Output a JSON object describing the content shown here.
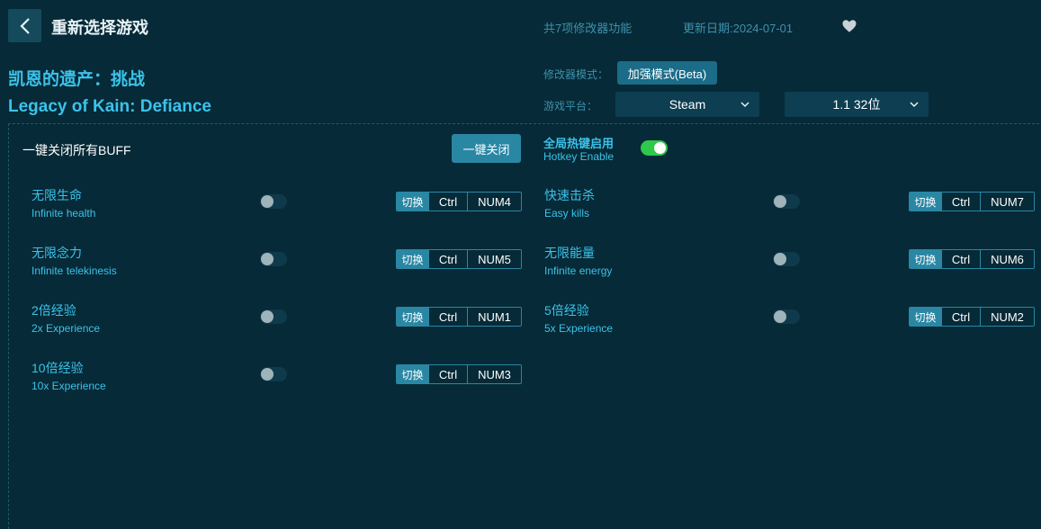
{
  "header": {
    "title": "重新选择游戏",
    "feature_count": "共7项修改器功能",
    "update_date": "更新日期:2024-07-01"
  },
  "game": {
    "title_cn": "凯恩的遗产：挑战",
    "title_en": "Legacy of Kain: Defiance"
  },
  "settings": {
    "mode_label": "修改器模式：",
    "mode_value": "加强模式(Beta)",
    "platform_label": "游戏平台：",
    "platform_value": "Steam",
    "version_value": "1.1 32位"
  },
  "controls": {
    "close_all_label": "一键关闭所有BUFF",
    "close_all_button": "一键关闭",
    "hotkey_cn": "全局热键启用",
    "hotkey_en": "Hotkey Enable",
    "hotkey_enabled": true
  },
  "options": [
    {
      "cn": "无限生命",
      "en": "Infinite health",
      "switch": "切换",
      "mod": "Ctrl",
      "key": "NUM4",
      "enabled": false
    },
    {
      "cn": "快速击杀",
      "en": "Easy kills",
      "switch": "切换",
      "mod": "Ctrl",
      "key": "NUM7",
      "enabled": false
    },
    {
      "cn": "无限念力",
      "en": "Infinite telekinesis",
      "switch": "切换",
      "mod": "Ctrl",
      "key": "NUM5",
      "enabled": false
    },
    {
      "cn": "无限能量",
      "en": "Infinite energy",
      "switch": "切换",
      "mod": "Ctrl",
      "key": "NUM6",
      "enabled": false
    },
    {
      "cn": "2倍经验",
      "en": "2x Experience",
      "switch": "切换",
      "mod": "Ctrl",
      "key": "NUM1",
      "enabled": false
    },
    {
      "cn": "5倍经验",
      "en": "5x Experience",
      "switch": "切换",
      "mod": "Ctrl",
      "key": "NUM2",
      "enabled": false
    },
    {
      "cn": "10倍经验",
      "en": "10x Experience",
      "switch": "切换",
      "mod": "Ctrl",
      "key": "NUM3",
      "enabled": false
    }
  ],
  "icons": {
    "back": "chevron-left-icon",
    "favorite": "heart-icon",
    "dropdown": "chevron-down-icon"
  },
  "colors": {
    "background": "#062a37",
    "accent": "#3cc2ea",
    "button": "#2a87a4",
    "toggle_on": "#2ec84b"
  }
}
